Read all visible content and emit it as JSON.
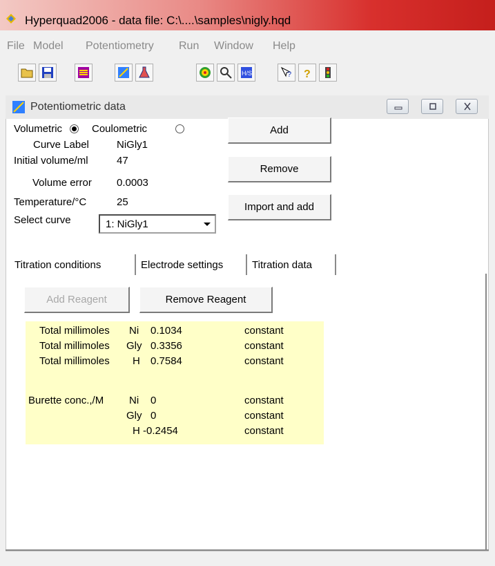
{
  "window": {
    "title": "Hyperquad2006 - data file: C:\\....\\samples\\nigly.hqd"
  },
  "menu": [
    "File",
    "Model",
    "Potentiometry",
    "Run",
    "Window",
    "Help"
  ],
  "child": {
    "title": "Potentiometric  data"
  },
  "form": {
    "volumetric_label": "Volumetric",
    "coulometric_label": "Coulometric",
    "curve_label_label": "Curve Label",
    "curve_label_value": "NiGly1",
    "initial_volume_label": "Initial volume/ml",
    "initial_volume_value": "47",
    "volume_error_label": "Volume error",
    "volume_error_value": "0.0003",
    "temperature_label": "Temperature/°C",
    "temperature_value": "25",
    "select_curve_label": "Select curve",
    "select_curve_value": "1:  NiGly1"
  },
  "buttons": {
    "add": "Add",
    "remove": "Remove",
    "import_add": "Import and add",
    "add_reagent": "Add Reagent",
    "remove_reagent": "Remove Reagent"
  },
  "tabs": [
    "Titration conditions",
    "Electrode settings",
    "Titration data"
  ],
  "reagents": {
    "total_rows": [
      {
        "label": "Total millimoles",
        "species": "Ni",
        "value": "0.1034",
        "status": "constant"
      },
      {
        "label": "Total millimoles",
        "species": "Gly",
        "value": "0.3356",
        "status": "constant"
      },
      {
        "label": "Total millimoles",
        "species": "H",
        "value": "0.7584",
        "status": "constant"
      }
    ],
    "burette_label": "Burette conc.,/M",
    "burette_rows": [
      {
        "species": "Ni",
        "value": "0",
        "status": "constant"
      },
      {
        "species": "Gly",
        "value": "0",
        "status": "constant"
      },
      {
        "species": "H",
        "value": "-0.2454",
        "status": "constant"
      }
    ]
  },
  "colors": {
    "titlebar_end": "#c51f1c",
    "reagent_panel": "#ffffc8",
    "menu_text": "#8a8a8a"
  }
}
